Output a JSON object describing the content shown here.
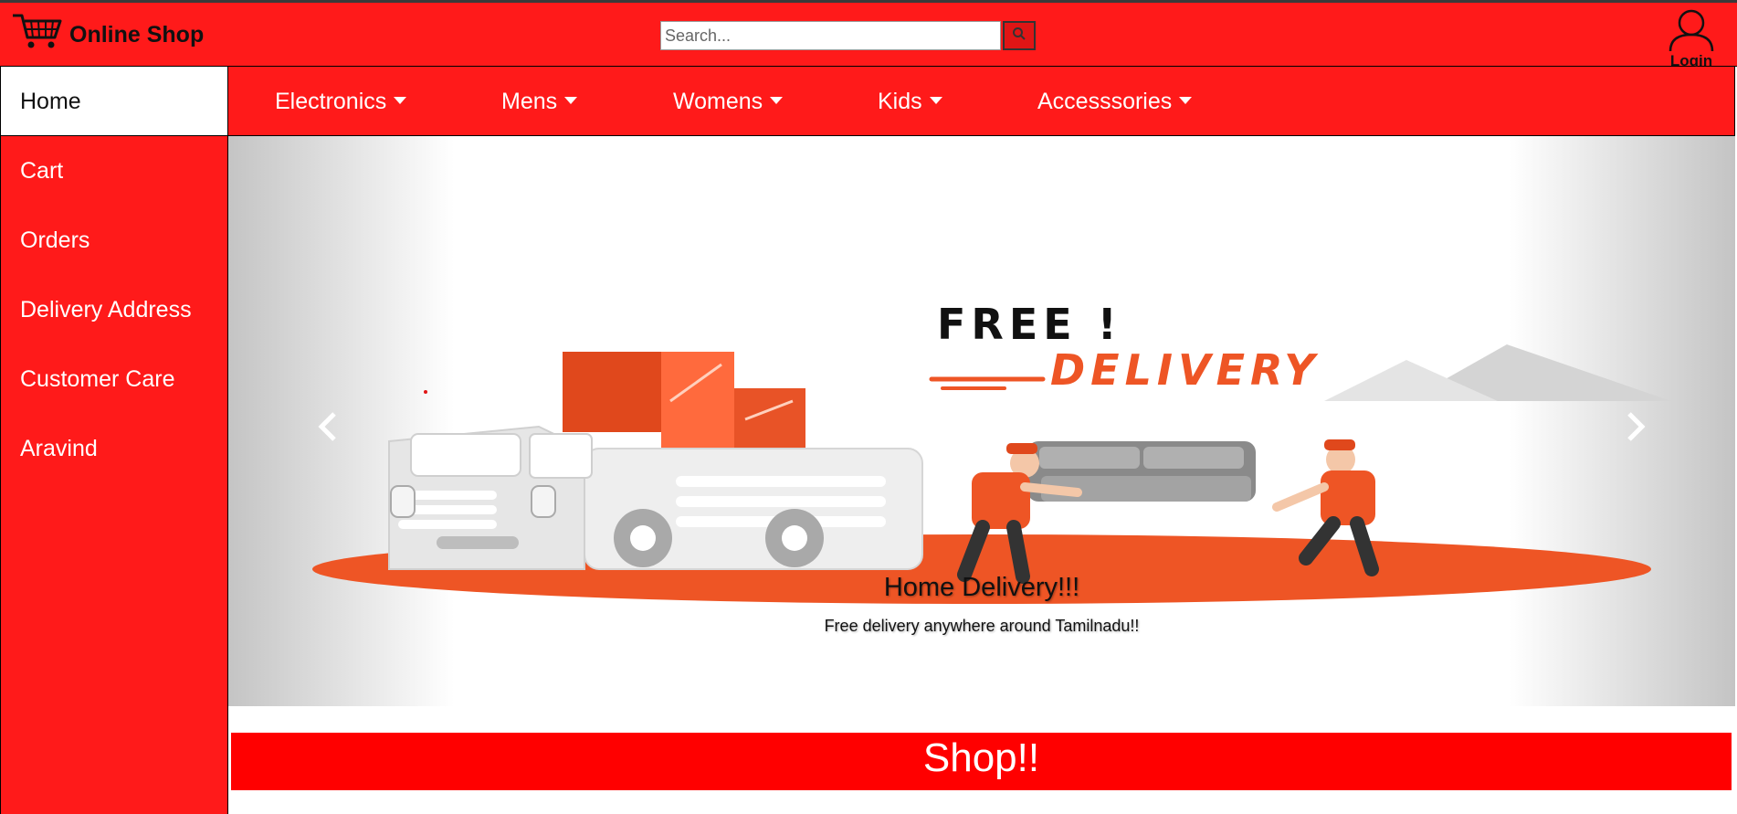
{
  "header": {
    "brand_title": "Online Shop",
    "search_placeholder": "Search...",
    "login_label": "Login"
  },
  "sidebar": {
    "items": [
      {
        "label": "Home",
        "active": true
      },
      {
        "label": "Cart"
      },
      {
        "label": "Orders"
      },
      {
        "label": "Delivery Address"
      },
      {
        "label": "Customer Care"
      },
      {
        "label": "Aravind"
      }
    ]
  },
  "navbar": {
    "items": [
      {
        "label": "Electronics"
      },
      {
        "label": "Mens"
      },
      {
        "label": "Womens"
      },
      {
        "label": "Kids"
      },
      {
        "label": "Accesssories"
      }
    ]
  },
  "carousel": {
    "banner_line1": "FREE !",
    "banner_line2": "DELIVERY",
    "caption_title": "Home Delivery!!!",
    "caption_text": "Free delivery anywhere around Tamilnadu!!"
  },
  "shop": {
    "title": "Shop!!"
  },
  "colors": {
    "brand_red": "#ff1a1a",
    "banner_orange": "#ee5525"
  }
}
